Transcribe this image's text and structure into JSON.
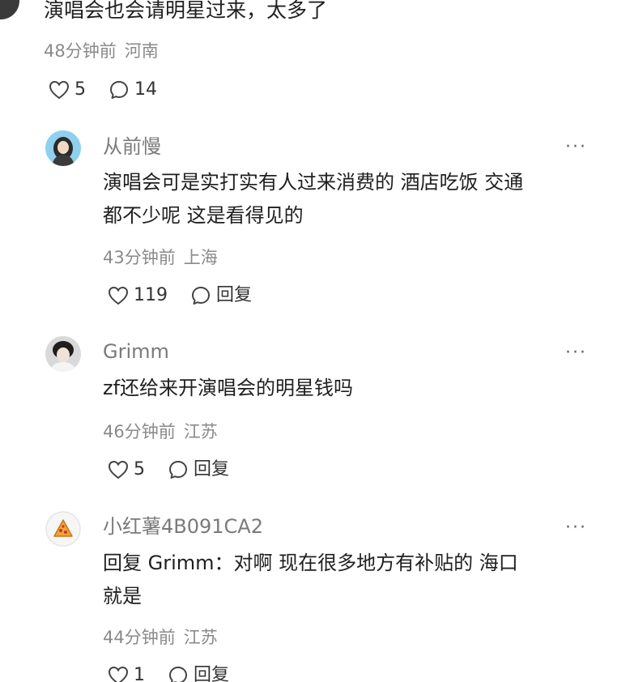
{
  "top_comment": {
    "text": "演唱会也会请明星过来，太多了",
    "time": "48分钟前",
    "location": "河南",
    "likes": "5",
    "replies": "14"
  },
  "replies": [
    {
      "username": "从前慢",
      "text_lines": [
        "演唱会可是实打实有人过来消费的 酒店吃饭 交通",
        "都不少呢 这是看得见的"
      ],
      "time": "43分钟前",
      "location": "上海",
      "likes": "119",
      "reply_label": "回复"
    },
    {
      "username": "Grimm",
      "text_lines": [
        "zf还给来开演唱会的明星钱吗"
      ],
      "time": "46分钟前",
      "location": "江苏",
      "likes": "5",
      "reply_label": "回复"
    },
    {
      "username": "小红薯4B091CA2",
      "text_lines": [
        "回复 Grimm：对啊 现在很多地方有补贴的 海口",
        "就是"
      ],
      "time": "44分钟前",
      "location": "江苏",
      "likes": "1",
      "reply_label": "回复"
    }
  ],
  "more_label": "···",
  "icons": [
    "heart-icon",
    "comment-bubble-icon",
    "more-options-icon"
  ],
  "colors": {
    "text": "#1f1f1f",
    "meta": "#8a8a8a",
    "username": "#7a7a7a"
  }
}
